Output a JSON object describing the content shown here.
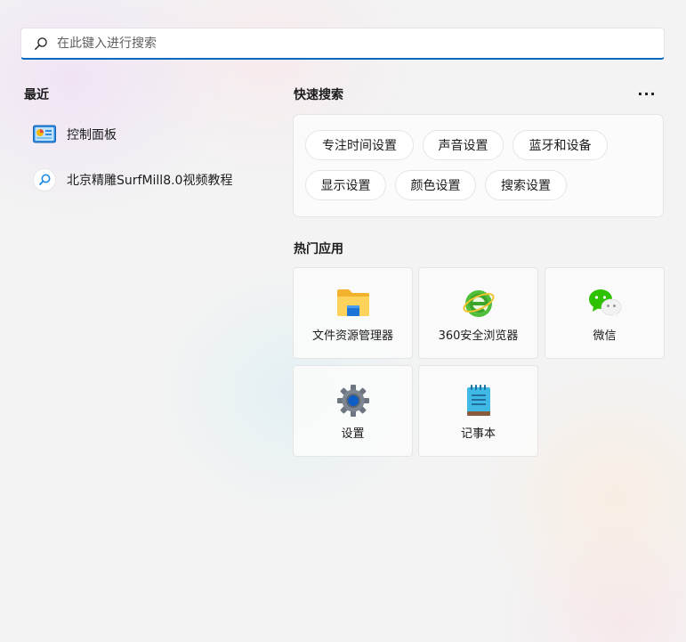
{
  "search": {
    "placeholder": "在此键入进行搜索",
    "icon": "search-icon"
  },
  "recent": {
    "title": "最近",
    "items": [
      {
        "label": "控制面板",
        "icon": "control-panel-icon"
      },
      {
        "label": "北京精雕SurfMill8.0视频教程",
        "icon": "web-search-icon"
      }
    ]
  },
  "quick_search": {
    "title": "快速搜索",
    "more": "···",
    "chips": [
      "专注时间设置",
      "声音设置",
      "蓝牙和设备",
      "显示设置",
      "颜色设置",
      "搜索设置"
    ]
  },
  "top_apps": {
    "title": "热门应用",
    "apps": [
      {
        "label": "文件资源管理器",
        "icon": "folder-icon"
      },
      {
        "label": "360安全浏览器",
        "icon": "360-browser-icon"
      },
      {
        "label": "微信",
        "icon": "wechat-icon"
      },
      {
        "label": "设置",
        "icon": "gear-icon"
      },
      {
        "label": "记事本",
        "icon": "notepad-icon"
      }
    ]
  },
  "colors": {
    "accent": "#0067c0",
    "background": "#f3f3f3"
  }
}
